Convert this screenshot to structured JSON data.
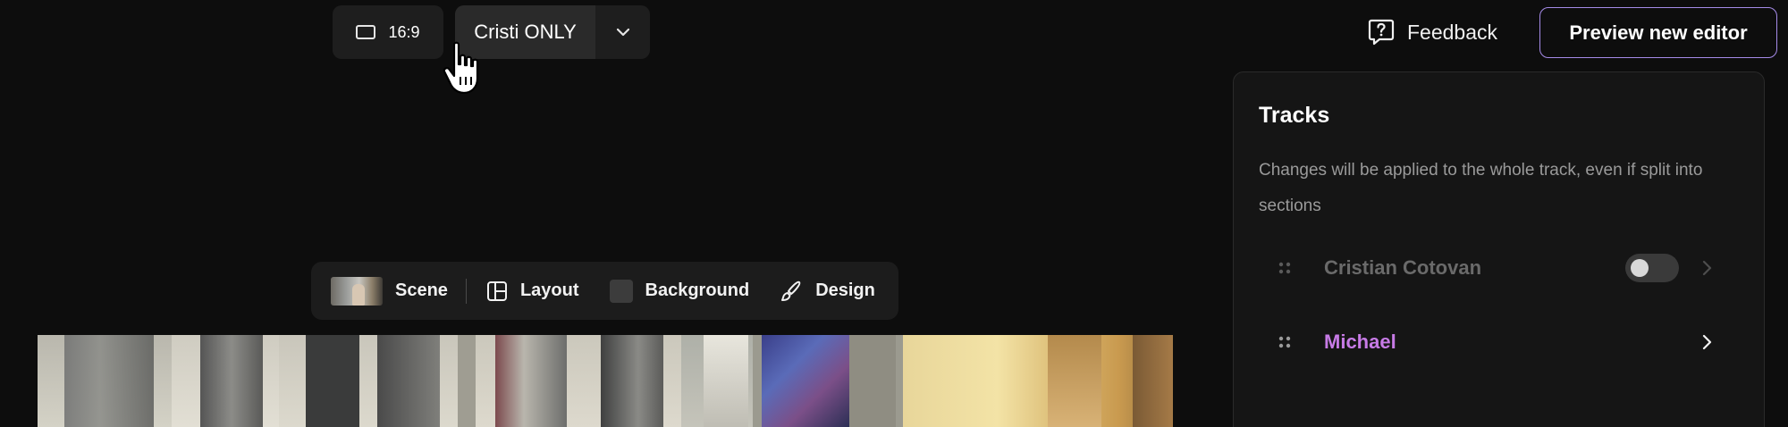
{
  "toolbar": {
    "aspect_ratio": "16:9",
    "layout_selected": "Cristi ONLY",
    "feedback_label": "Feedback",
    "preview_button_label": "Preview new editor"
  },
  "scene_toolbar": {
    "scene_label": "Scene",
    "layout_label": "Layout",
    "background_label": "Background",
    "design_label": "Design"
  },
  "tracks": {
    "title": "Tracks",
    "description": "Changes will be applied to the whole track, even if split into sections",
    "items": [
      {
        "name": "Cristian Cotovan",
        "toggle_on": false,
        "name_color": "#6a6a6a"
      },
      {
        "name": "Michael",
        "name_color": "#c77be6"
      }
    ]
  },
  "colors": {
    "background": "#0d0d0d",
    "surface": "#1e1e1e",
    "accent_border": "#a58be8",
    "highlight_track": "#c77be6"
  }
}
